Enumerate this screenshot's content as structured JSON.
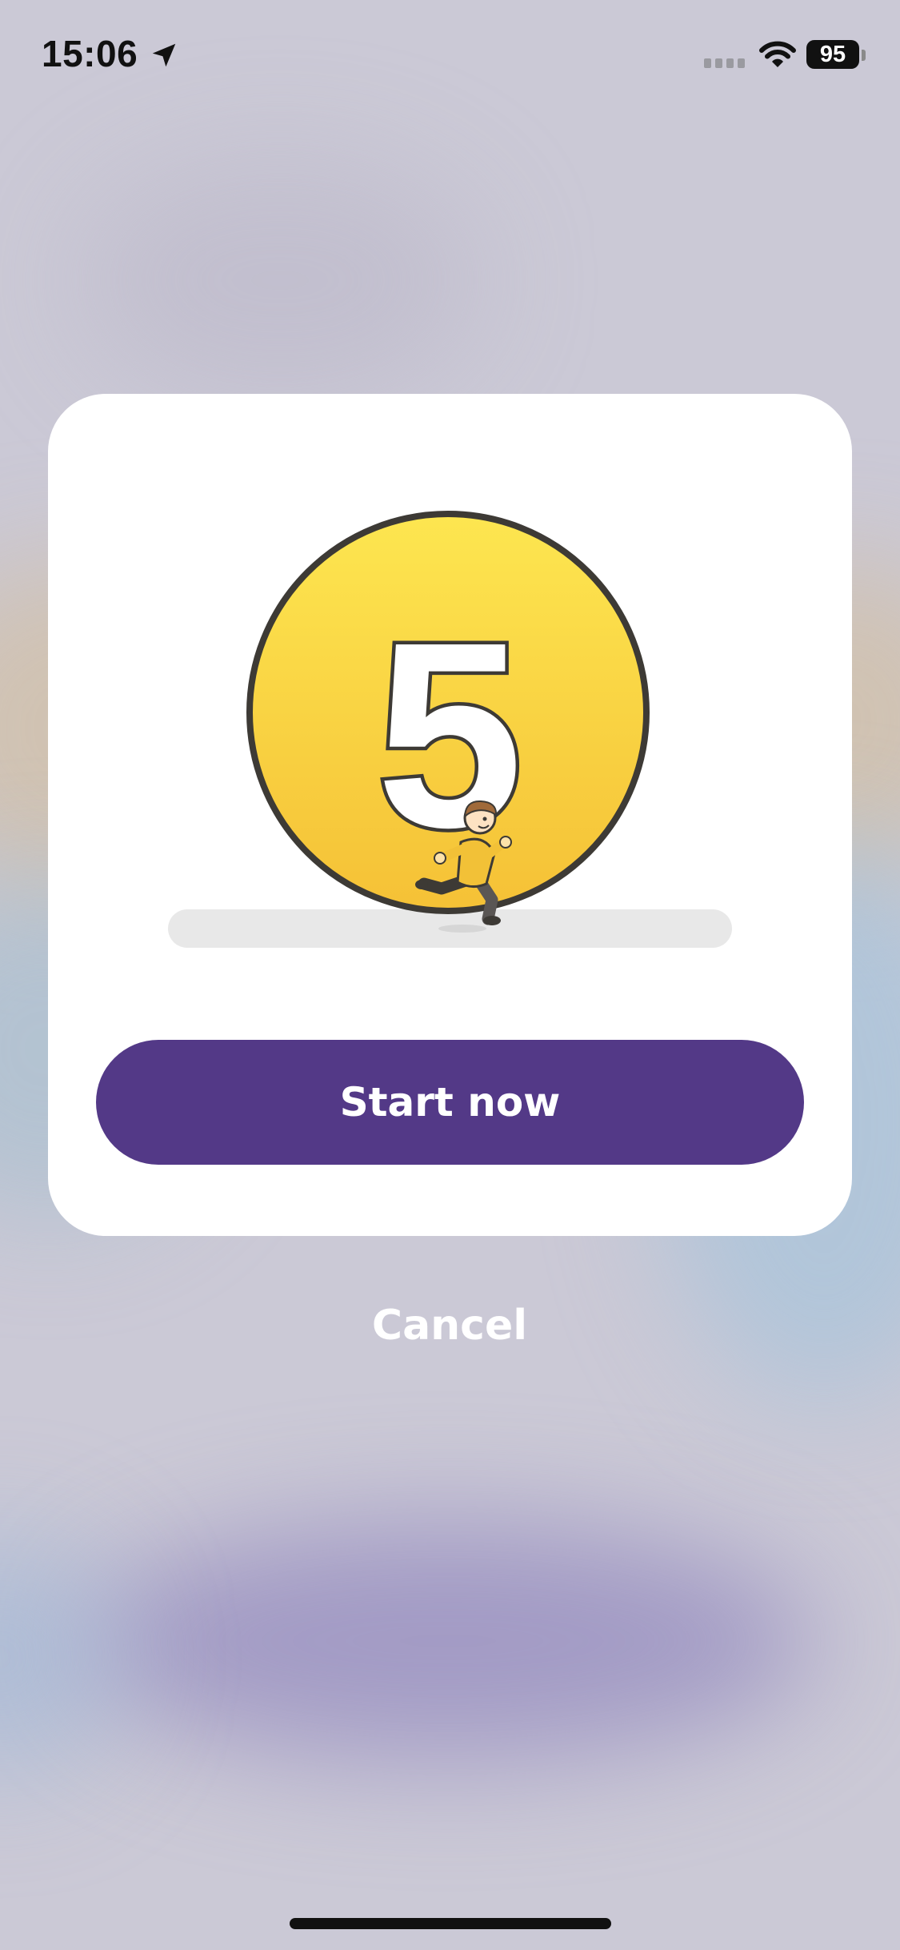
{
  "status_bar": {
    "time": "15:06",
    "battery_level": "95",
    "icons": [
      "location-arrow-icon",
      "signal-icon",
      "wifi-icon",
      "battery-icon"
    ]
  },
  "dialog": {
    "badge_number": "5",
    "illustration": "running-person-icon",
    "start_label": "Start now",
    "cancel_label": "Cancel"
  },
  "colors": {
    "primary": "#533987",
    "badge_yellow": "#fbd845",
    "card_background": "#ffffff"
  }
}
